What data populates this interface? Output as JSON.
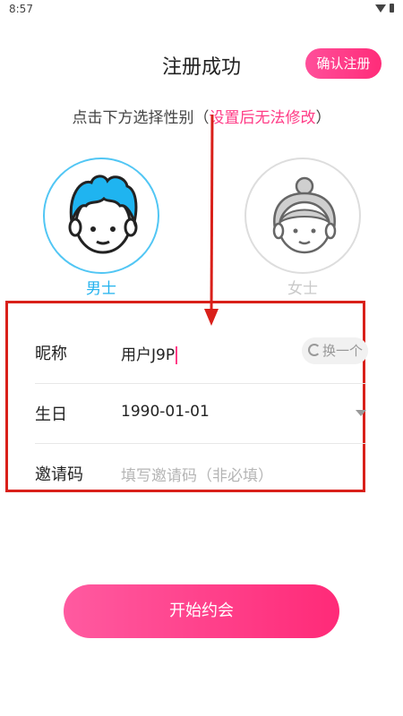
{
  "status_bar": {
    "time": "8:57"
  },
  "header": {
    "title": "注册成功",
    "confirm_label": "确认注册"
  },
  "instruction": {
    "prefix": "点击下方选择性别（",
    "warning": "设置后无法修改",
    "suffix": "）"
  },
  "gender": {
    "male_label": "男士",
    "female_label": "女士",
    "selected": "male"
  },
  "form": {
    "nickname": {
      "label": "昵称",
      "value": "用户J9P",
      "refresh_label": "换一个"
    },
    "birthday": {
      "label": "生日",
      "value": "1990-01-01"
    },
    "invite": {
      "label": "邀请码",
      "placeholder": "填写邀请码（非必填）"
    }
  },
  "start_button": {
    "label": "开始约会"
  },
  "colors": {
    "accent": "#ff3b86",
    "male": "#51c6f4",
    "annotation": "#d9201a"
  }
}
